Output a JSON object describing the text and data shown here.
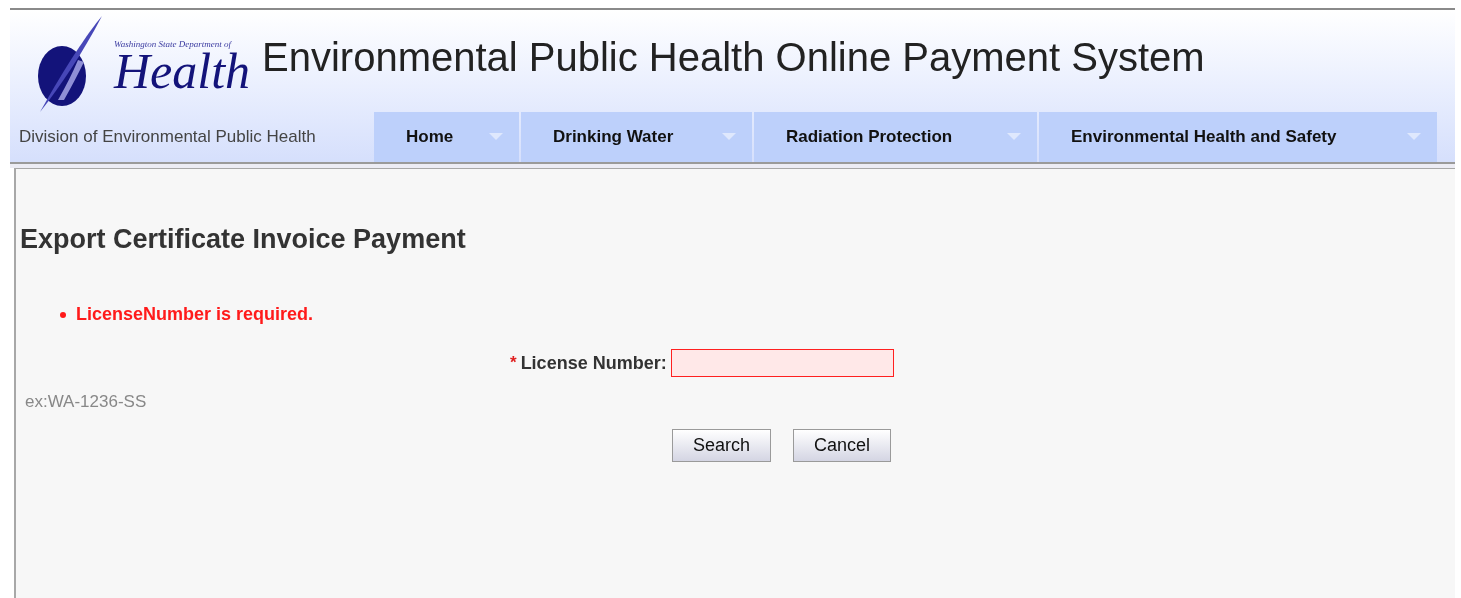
{
  "header": {
    "logo": {
      "line_1": "Washington State Department of",
      "line_2": "Health"
    },
    "title": "Environmental Public Health Online Payment System"
  },
  "nav": {
    "division": "Division of Environmental Public Health",
    "items": [
      {
        "label": "Home"
      },
      {
        "label": "Drinking Water"
      },
      {
        "label": "Radiation Protection"
      },
      {
        "label": "Environmental Health and Safety"
      }
    ]
  },
  "page": {
    "heading": "Export Certificate Invoice Payment",
    "errors": [
      "LicenseNumber is required."
    ],
    "field": {
      "required_mark": "*",
      "label": "License Number:",
      "invalid": true
    },
    "hint": "ex:WA-1236-SS",
    "buttons": [
      "Search",
      "Cancel"
    ]
  }
}
